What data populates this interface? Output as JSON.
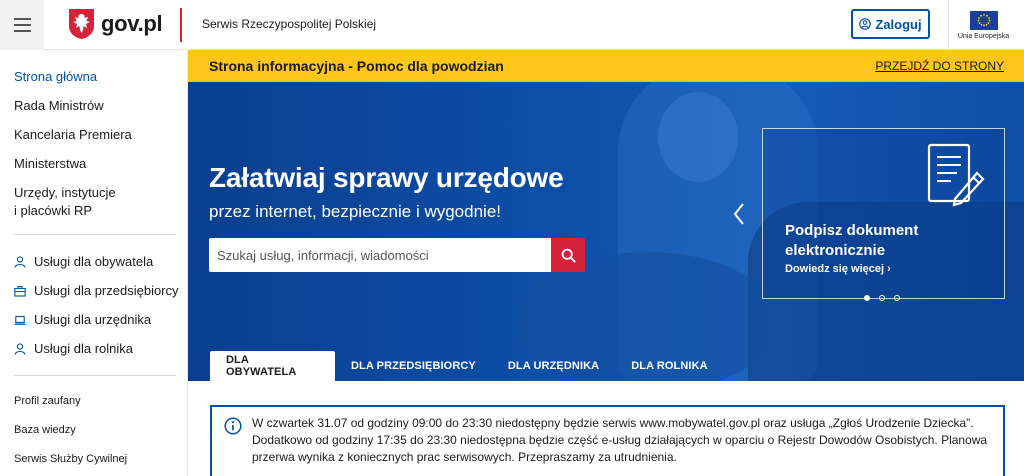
{
  "header": {
    "logo_text": "gov.pl",
    "tagline": "Serwis Rzeczypospolitej Polskiej",
    "login_label": "Zaloguj",
    "eu_label": "Unia Europejska"
  },
  "sidebar": {
    "primary": [
      {
        "label": "Strona główna",
        "active": true
      },
      {
        "label": "Rada Ministrów"
      },
      {
        "label": "Kancelaria Premiera"
      },
      {
        "label": "Ministerstwa"
      },
      {
        "label": "Urzędy, instytucje"
      },
      {
        "label": "i placówki RP"
      }
    ],
    "services": [
      {
        "label": "Usługi dla obywatela",
        "icon": "person-icon"
      },
      {
        "label": "Usługi dla przedsiębiorcy",
        "icon": "briefcase-icon"
      },
      {
        "label": "Usługi dla urzędnika",
        "icon": "laptop-icon"
      },
      {
        "label": "Usługi dla rolnika",
        "icon": "person-icon"
      }
    ],
    "secondary": [
      {
        "label": "Profil zaufany"
      },
      {
        "label": "Baza wiedzy"
      },
      {
        "label": "Serwis Służby Cywilnej"
      }
    ]
  },
  "banner": {
    "title": "Strona informacyjna - Pomoc dla powodzian",
    "link": "PRZEJDŹ DO STRONY"
  },
  "hero": {
    "title": "Załatwiaj sprawy urzędowe",
    "subtitle": "przez internet, bezpiecznie i wygodnie!",
    "search_placeholder": "Szukaj usług, informacji, wiadomości"
  },
  "carousel": {
    "card_title": "Podpisz dokument elektronicznie",
    "card_link": "Dowiedz się więcej",
    "slides": 3,
    "active_slide": 1
  },
  "tabs": [
    {
      "label": "DLA OBYWATELA",
      "active": true
    },
    {
      "label": "DLA PRZEDSIĘBIORCY"
    },
    {
      "label": "DLA URZĘDNIKA"
    },
    {
      "label": "DLA ROLNIKA"
    }
  ],
  "notice": {
    "text": "W czwartek 31.07 od godziny 09:00 do 23:30 niedostępny będzie serwis www.mobywatel.gov.pl oraz usługa „Zgłoś Urodzenie Dziecka”. Dodatkowo od godziny 17:35 do 23:30 niedostępna będzie część e-usług działających w oparciu o Rejestr Dowodów Osobistych. Planowa przerwa wynika z koniecznych prac serwisowych. Przepraszamy za utrudnienia."
  },
  "colors": {
    "brand_red": "#d5233b",
    "brand_blue": "#0052a5",
    "banner_yellow": "#ffc61a"
  }
}
